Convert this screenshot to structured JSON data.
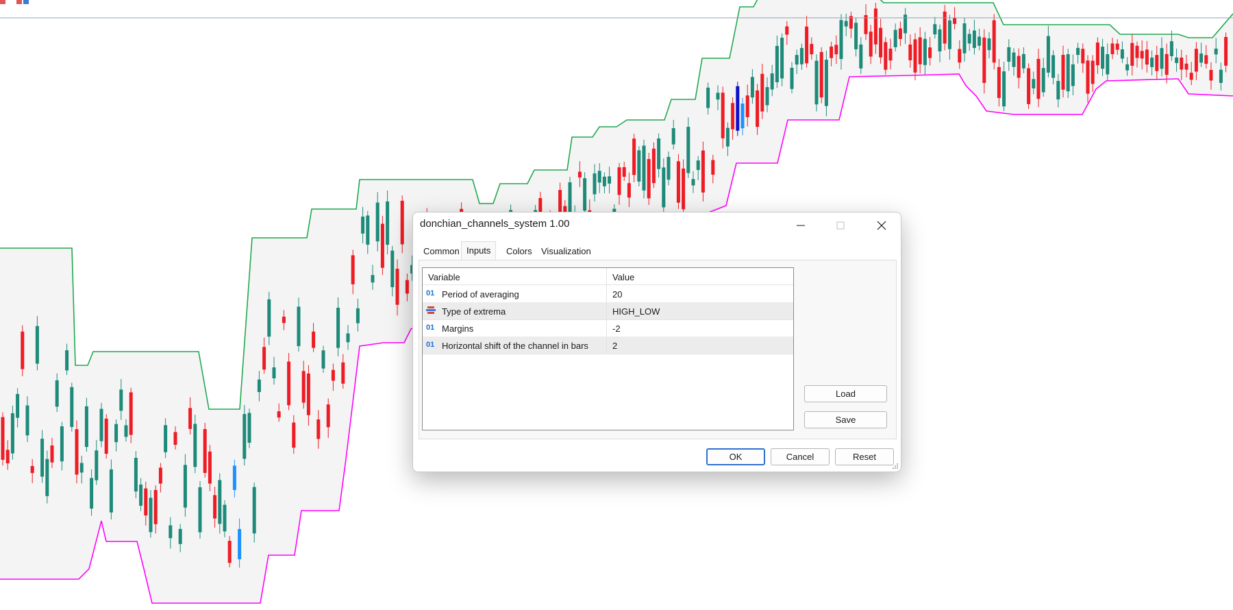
{
  "chart_data": {
    "type": "candlestick",
    "indicator": "donchian_channels_system",
    "colors": {
      "bull": "#1e8a7a",
      "bear": "#ee1c25",
      "channel_upper": "#1fa84f",
      "channel_lower": "#ff00ff",
      "channel_fill": "#f4f4f4",
      "signal_up": "#1e90ff",
      "signal_down": "#1010c8",
      "price_line": "#8fa3b5"
    },
    "grid": false,
    "legend": "none"
  },
  "dialog": {
    "title": "donchian_channels_system 1.00",
    "controls": {
      "minimize_icon": "minimize-icon",
      "maximize_icon": "maximize-icon",
      "close_icon": "close-icon"
    },
    "tabs": [
      "Common",
      "Inputs",
      "Colors",
      "Visualization"
    ],
    "active_tab": "Inputs",
    "table": {
      "headers": {
        "variable": "Variable",
        "value": "Value"
      },
      "rows": [
        {
          "icon": "int-param-icon",
          "icon_text": "01",
          "variable": "Period of averaging",
          "value": "20"
        },
        {
          "icon": "enum-param-icon",
          "icon_text": "",
          "variable": "Type of extrema",
          "value": "HIGH_LOW"
        },
        {
          "icon": "int-param-icon",
          "icon_text": "01",
          "variable": "Margins",
          "value": "-2"
        },
        {
          "icon": "int-param-icon",
          "icon_text": "01",
          "variable": "Horizontal shift of the channel in bars",
          "value": "2"
        }
      ]
    },
    "side_buttons": {
      "load": "Load",
      "save": "Save"
    },
    "footer_buttons": {
      "ok": "OK",
      "cancel": "Cancel",
      "reset": "Reset"
    }
  }
}
